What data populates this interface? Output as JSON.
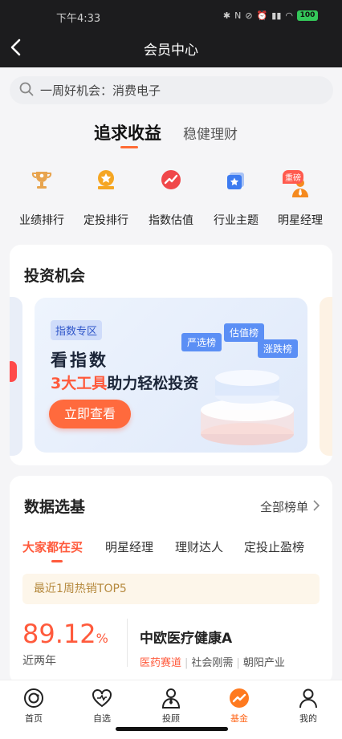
{
  "status_bar": {
    "time": "下午4:33",
    "battery": "100"
  },
  "nav": {
    "title": "会员中心"
  },
  "search": {
    "placeholder": "一周好机会：消费电子"
  },
  "tabs": {
    "active": "追求收益",
    "inactive": "稳健理财"
  },
  "features": [
    {
      "label": "业绩排行",
      "icon": "trophy-icon"
    },
    {
      "label": "定投排行",
      "icon": "medal-icon"
    },
    {
      "label": "指数估值",
      "icon": "chart-trend-icon"
    },
    {
      "label": "行业主题",
      "icon": "star-badge-icon"
    },
    {
      "label": "明星经理",
      "icon": "manager-icon",
      "badge": "重磅"
    }
  ],
  "opportunity": {
    "title": "投资机会",
    "banner": {
      "tag": "指数专区",
      "headline": "看指数",
      "subline_highlight": "3大工具",
      "subline_rest": "助力轻松投资",
      "button": "立即查看",
      "rank_tags": [
        "严选榜",
        "估值榜",
        "涨跌榜"
      ]
    }
  },
  "data_select": {
    "title": "数据选基",
    "all_rank": "全部榜单",
    "subtabs": [
      "大家都在买",
      "明星经理",
      "理财达人",
      "定投止盈榜"
    ],
    "hot_label": "最近1周热销TOP5",
    "fund": {
      "rate": "89.12",
      "rate_unit": "%",
      "period": "近两年",
      "name": "中欧医疗健康A",
      "tags": [
        "医药赛道",
        "社会刚需",
        "朝阳产业"
      ]
    }
  },
  "bottom_nav": [
    {
      "label": "首页",
      "icon": "home-icon"
    },
    {
      "label": "自选",
      "icon": "heart-icon"
    },
    {
      "label": "投顾",
      "icon": "advisor-icon"
    },
    {
      "label": "基金",
      "icon": "fund-icon",
      "active": true
    },
    {
      "label": "我的",
      "icon": "profile-icon"
    }
  ],
  "colors": {
    "accent": "#ff6a3d",
    "topbar": "#1c1c1e",
    "active_tab": "#ff5a3c"
  }
}
